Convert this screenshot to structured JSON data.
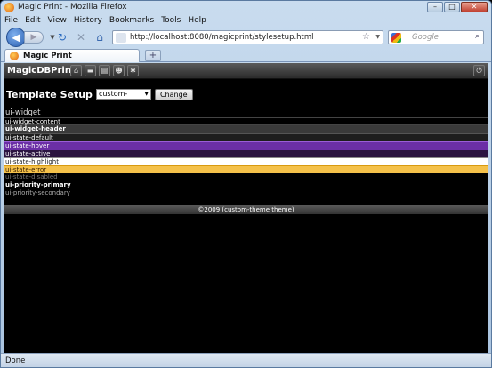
{
  "window": {
    "title": "Magic Print - Mozilla Firefox",
    "minimize": "–",
    "maximize": "□",
    "close": "✕"
  },
  "menu": [
    "File",
    "Edit",
    "View",
    "History",
    "Bookmarks",
    "Tools",
    "Help"
  ],
  "nav": {
    "url": "http://localhost:8080/magicprint/stylesetup.html",
    "search_placeholder": "Google"
  },
  "tab": {
    "label": "Magic Print",
    "new_tab": "+"
  },
  "app": {
    "title": "MagicDBPrint"
  },
  "setup": {
    "label": "Template Setup",
    "selected_theme": "custom-theme",
    "change_label": "Change"
  },
  "widgets": {
    "widget": "ui-widget",
    "content": "ui-widget-content",
    "header": "ui-widget-header",
    "default": "ui-state-default",
    "hover": "ui-state-hover",
    "active": "ui-state-active",
    "highlight": "ui-state-highlight",
    "error": "ui-state-error",
    "disabled": "ui-state-disabled",
    "primary": "ui-priority-primary",
    "secondary": "ui-priority-secondary"
  },
  "footer": "©2009 (custom-theme theme)",
  "status": "Done",
  "colors": {
    "hover": "#6b2fa6",
    "highlight": "#ffffff",
    "error": "#f4c14a",
    "header": "#3a3a3a"
  }
}
